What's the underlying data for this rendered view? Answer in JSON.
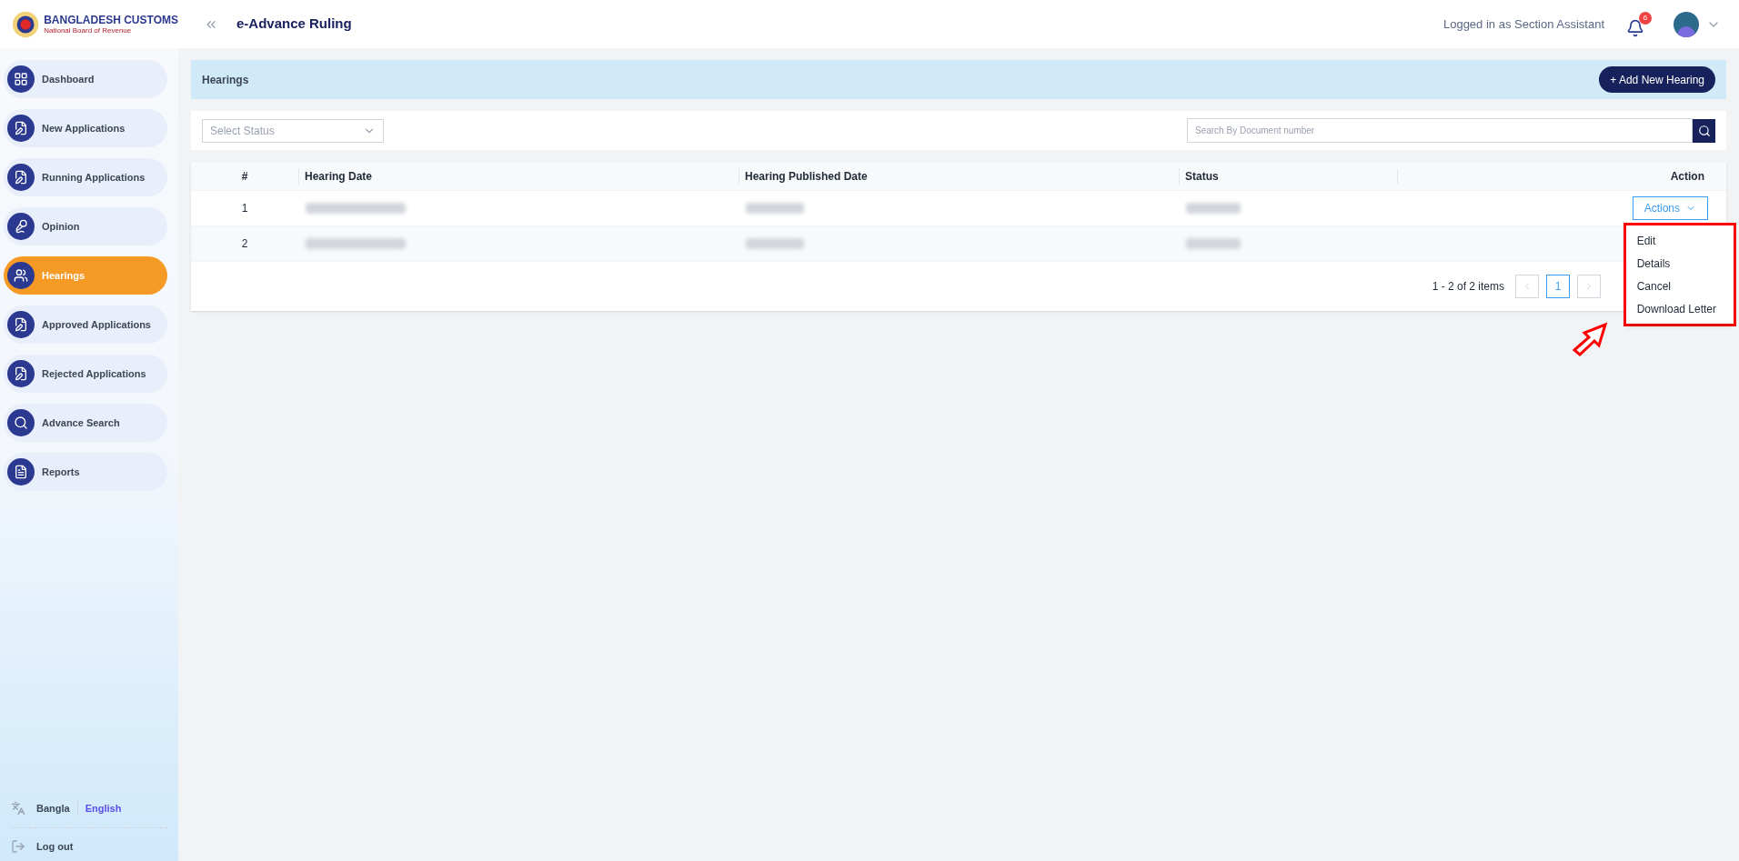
{
  "header": {
    "logo_title": "BANGLADESH CUSTOMS",
    "logo_subtitle": "National Board of Revenue",
    "app_title": "e-Advance Ruling",
    "user_text": "Logged in as Section Assistant",
    "notification_count": "6"
  },
  "sidebar": {
    "items": [
      {
        "label": "Dashboard",
        "kind": "grid",
        "selected": false
      },
      {
        "label": "New Applications",
        "kind": "doc",
        "selected": false
      },
      {
        "label": "Running Applications",
        "kind": "doc",
        "selected": false
      },
      {
        "label": "Opinion",
        "kind": "voice",
        "selected": false
      },
      {
        "label": "Hearings",
        "kind": "hearing",
        "selected": true
      },
      {
        "label": "Approved Applications",
        "kind": "doc",
        "selected": false
      },
      {
        "label": "Rejected Applications",
        "kind": "doc",
        "selected": false
      },
      {
        "label": "Advance Search",
        "kind": "search",
        "selected": false
      },
      {
        "label": "Reports",
        "kind": "report",
        "selected": false
      }
    ],
    "languages": [
      {
        "label": "Bangla",
        "selected": false
      },
      {
        "label": "English",
        "selected": true
      }
    ],
    "logout": "Log out"
  },
  "page": {
    "title": "Hearings",
    "add_button": "+ Add New Hearing"
  },
  "filters": {
    "status_placeholder": "Select Status",
    "search_placeholder": "Search By Document number"
  },
  "table": {
    "columns": [
      "#",
      "Hearing Date",
      "Hearing Published Date",
      "Status",
      "Action"
    ],
    "rows": [
      {
        "number": "1",
        "actions_label": "Actions"
      },
      {
        "number": "2"
      }
    ]
  },
  "actions_menu": {
    "items": [
      "Edit",
      "Details",
      "Cancel",
      "Download Letter"
    ]
  },
  "pagination": {
    "summary": "1 - 2 of 2 items",
    "pages": [
      {
        "label": "1",
        "selected": true
      }
    ]
  }
}
